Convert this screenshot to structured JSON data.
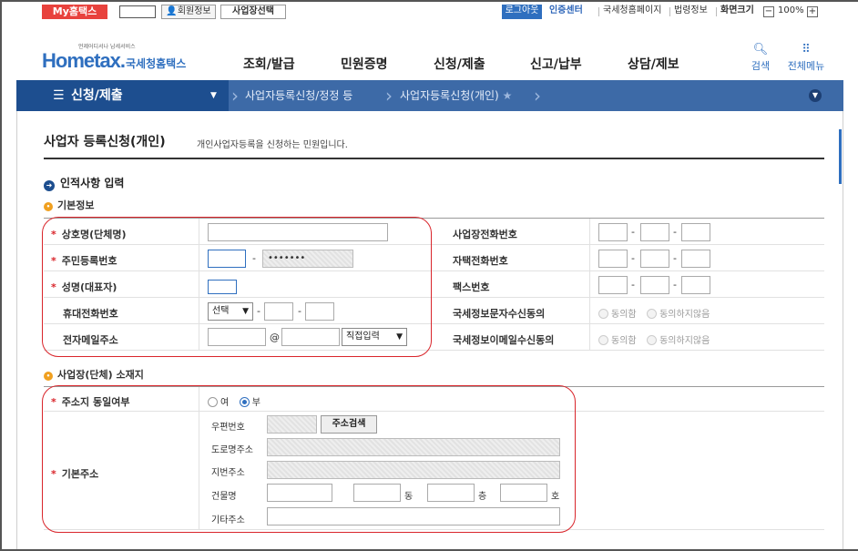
{
  "topbar": {
    "my_label": "My홈택스",
    "member_label": "회원정보",
    "bizselect_label": "사업장선택",
    "logout_label": "로그아웃",
    "cert_label": "인증센터",
    "nts_label": "국세청홈페이지",
    "law_label": "법령정보",
    "zoom_label": "화면크기",
    "zoom_minus": "−",
    "zoom_value": "100%",
    "zoom_plus": "+"
  },
  "header": {
    "logo_small": "언제어디서나 납세서비스",
    "logo_main": "Hometax.",
    "logo_sub": "국세청홈택스",
    "nav": [
      "조회/발급",
      "민원증명",
      "신청/제출",
      "신고/납부",
      "상담/제보"
    ],
    "search_label": "검색",
    "allmenu_label": "전체메뉴"
  },
  "location": {
    "menu_label": "신청/제출",
    "crumb1": "사업자등록신청/정정 등",
    "crumb2": "사업자등록신청(개인)",
    "star": "★"
  },
  "page": {
    "title": "사업자 등록신청(개인)",
    "desc": "개인사업자등록을 신청하는 민원입니다.",
    "section1": "인적사항 입력",
    "sub1": "기본정보",
    "sub2": "사업장(단체) 소재지"
  },
  "basic": {
    "trade_name": "상호명(단체명)",
    "resident_no": "주민등록번호",
    "resident_masked": "•••••••",
    "name": "성명(대표자)",
    "mobile": "휴대전화번호",
    "mobile_select": "선택",
    "email": "전자메일주소",
    "email_at": "@",
    "email_select": "직접입력",
    "biz_phone": "사업장전화번호",
    "home_phone": "자택전화번호",
    "fax": "팩스번호",
    "sms_consent": "국세정보문자수신동의",
    "email_consent": "국세정보이메일수신동의",
    "agree": "동의함",
    "disagree": "동의하지않음",
    "dash": "-",
    "required": "*"
  },
  "address": {
    "same_label": "주소지 동일여부",
    "yes": "여",
    "no": "부",
    "basic_label": "기본주소",
    "zip": "우편번호",
    "search_btn": "주소검색",
    "road": "도로명주소",
    "jibun": "지번주소",
    "building": "건물명",
    "dong": "동",
    "floor": "층",
    "ho": "호",
    "etc": "기타주소"
  },
  "icons": {
    "member": "person-icon",
    "search": "magnifier-icon",
    "allmenu": "grid-icon",
    "menu": "hamburger-icon",
    "section": "arrow-circle-icon",
    "sub": "orange-circle-icon"
  },
  "colors": {
    "accent": "#2f6fbf",
    "nav_dark": "#1d4e8f",
    "highlight": "#d9252b",
    "my_red": "#e8423d"
  }
}
